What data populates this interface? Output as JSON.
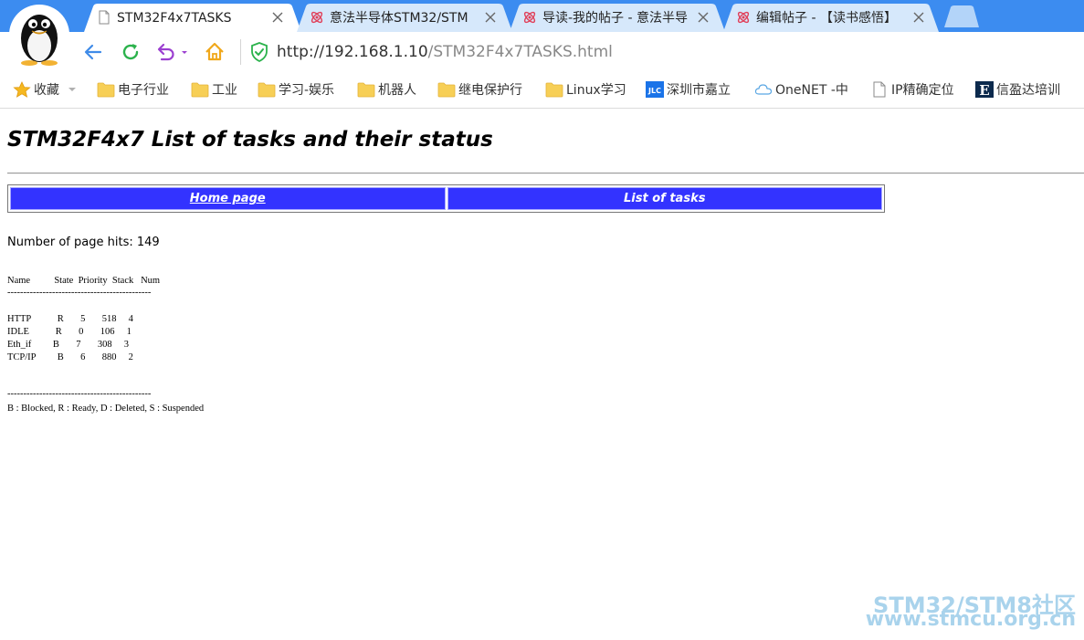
{
  "tabs": [
    {
      "title": "STM32F4x7TASKS",
      "icon": "page-icon",
      "active": true
    },
    {
      "title": "意法半导体STM32/STM",
      "icon": "stmcu-icon",
      "active": false
    },
    {
      "title": "导读-我的帖子 - 意法半导",
      "icon": "stmcu-icon",
      "active": false
    },
    {
      "title": "编辑帖子 - 【读书感悟】",
      "icon": "stmcu-icon",
      "active": false
    }
  ],
  "address_bar": {
    "host": "http://192.168.1.10",
    "path": "/STM32F4x7TASKS.html"
  },
  "bookmarks": [
    {
      "label": "收藏",
      "icon": "star-icon"
    },
    {
      "label": "电子行业",
      "icon": "folder-icon"
    },
    {
      "label": "工业",
      "icon": "folder-icon"
    },
    {
      "label": "学习-娱乐",
      "icon": "folder-icon"
    },
    {
      "label": "机器人",
      "icon": "folder-icon"
    },
    {
      "label": "继电保护行",
      "icon": "folder-icon"
    },
    {
      "label": "Linux学习",
      "icon": "folder-icon"
    },
    {
      "label": "深圳市嘉立",
      "icon": "jlc-icon",
      "icon_text": "JLC"
    },
    {
      "label": "OneNET -中",
      "icon": "cloud-icon"
    },
    {
      "label": "IP精确定位",
      "icon": "page-icon"
    },
    {
      "label": "信盈达培训",
      "icon": "e-logo-icon",
      "icon_text": "E"
    }
  ],
  "page": {
    "title": "STM32F4x7 List of tasks and their status",
    "menu": {
      "home": "Home page",
      "tasks": "List of tasks"
    },
    "hits_text": "Number of page hits: 149",
    "task_header": "Name          State  Priority  Stack   Num",
    "divider": "---------------------------------------------",
    "task_rows": [
      "HTTP           R       5       518     4",
      "IDLE           R       0       106     1",
      "Eth_if         B       7       308     3",
      "TCP/IP         B       6       880     2"
    ],
    "legend": "B : Blocked, R : Ready, D : Deleted, S : Suspended"
  },
  "watermark": {
    "line1": "STM32/STM8社区",
    "line2": "www.stmcu.org.cn"
  },
  "colors": {
    "tabstrip": "#3c8cf0",
    "menu_cell": "#3333ff",
    "watermark": "#a9d3ec"
  }
}
